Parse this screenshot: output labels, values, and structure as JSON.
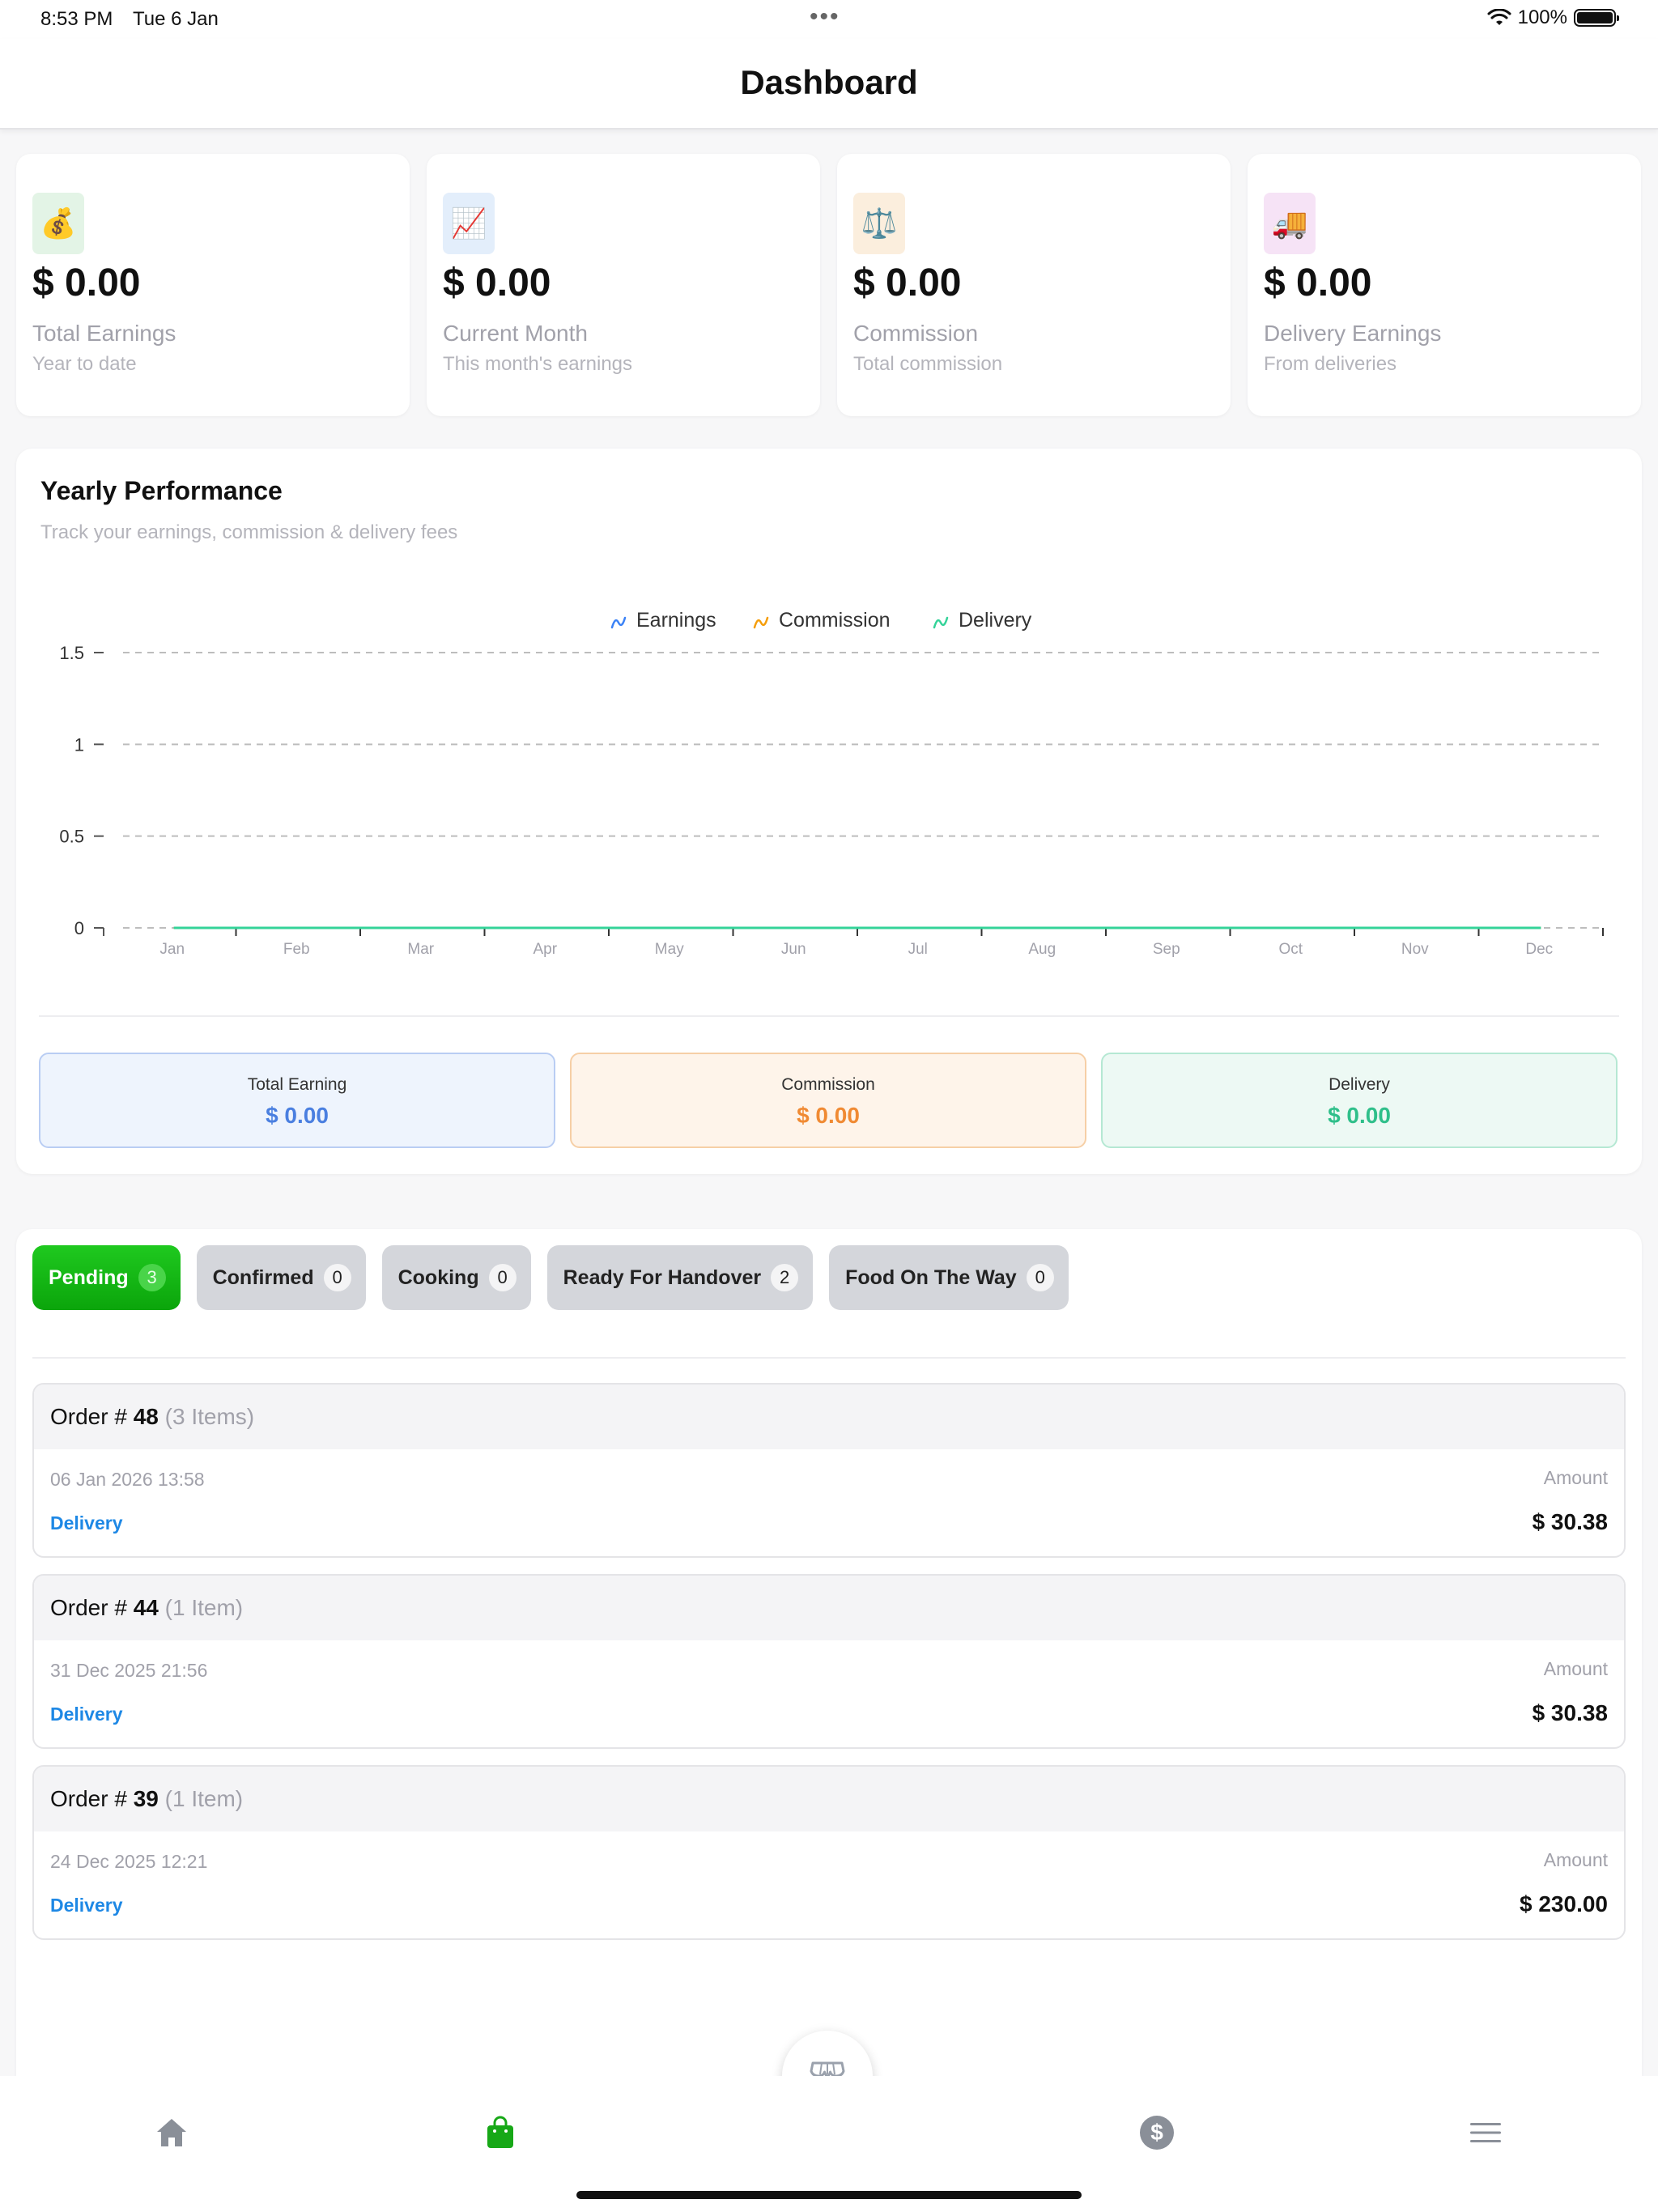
{
  "status_bar": {
    "time": "8:53 PM",
    "date": "Tue 6 Jan",
    "battery": "100%"
  },
  "header": {
    "title": "Dashboard"
  },
  "stats": [
    {
      "icon": "money-bag-icon",
      "glyph": "💰",
      "bg": "#e3f4e6",
      "value": "$ 0.00",
      "title": "Total Earnings",
      "subtitle": "Year to date"
    },
    {
      "icon": "chart-increasing-icon",
      "glyph": "📈",
      "bg": "#e3eefb",
      "value": "$ 0.00",
      "title": "Current Month",
      "subtitle": "This month's earnings"
    },
    {
      "icon": "balance-scale-icon",
      "glyph": "⚖️",
      "bg": "#fbeedd",
      "value": "$ 0.00",
      "title": "Commission",
      "subtitle": "Total commission"
    },
    {
      "icon": "delivery-truck-icon",
      "glyph": "🚚",
      "bg": "#f6e3f6",
      "value": "$ 0.00",
      "title": "Delivery Earnings",
      "subtitle": "From deliveries"
    }
  ],
  "performance": {
    "title": "Yearly Performance",
    "subtitle": "Track your earnings, commission & delivery fees",
    "summary": [
      {
        "label": "Total Earning",
        "value": "$ 0.00",
        "color": "#4a7fe0",
        "bg": "#eef4fd",
        "border": "#b9cdf3"
      },
      {
        "label": "Commission",
        "value": "$ 0.00",
        "color": "#f08a33",
        "bg": "#fef4ea",
        "border": "#f6cfa6"
      },
      {
        "label": "Delivery",
        "value": "$ 0.00",
        "color": "#2fbf8a",
        "bg": "#edf9f4",
        "border": "#b5e8d3"
      }
    ]
  },
  "chart_data": {
    "type": "line",
    "title": "",
    "x": [
      "Jan",
      "Feb",
      "Mar",
      "Apr",
      "May",
      "Jun",
      "Jul",
      "Aug",
      "Sep",
      "Oct",
      "Nov",
      "Dec"
    ],
    "series": [
      {
        "name": "Earnings",
        "color": "#3b82f6",
        "values": [
          0,
          0,
          0,
          0,
          0,
          0,
          0,
          0,
          0,
          0,
          0,
          0
        ]
      },
      {
        "name": "Commission",
        "color": "#f59e0b",
        "values": [
          0,
          0,
          0,
          0,
          0,
          0,
          0,
          0,
          0,
          0,
          0,
          0
        ]
      },
      {
        "name": "Delivery",
        "color": "#34d399",
        "values": [
          0,
          0,
          0,
          0,
          0,
          0,
          0,
          0,
          0,
          0,
          0,
          0
        ]
      }
    ],
    "y_ticks": [
      "0",
      "0.5",
      "1",
      "1.5"
    ],
    "ylim": [
      0,
      1.5
    ],
    "grid": true,
    "legend": "top-center"
  },
  "orders": {
    "tabs": [
      {
        "label": "Pending",
        "count": "3",
        "active": true
      },
      {
        "label": "Confirmed",
        "count": "0"
      },
      {
        "label": "Cooking",
        "count": "0"
      },
      {
        "label": "Ready For Handover",
        "count": "2"
      },
      {
        "label": "Food On The Way",
        "count": "0"
      }
    ],
    "list": [
      {
        "prefix": "Order # ",
        "number": "48",
        "items": "(3 Items)",
        "date": "06 Jan 2026  13:58",
        "type": "Delivery",
        "amount_label": "Amount",
        "amount": "$ 30.38"
      },
      {
        "prefix": "Order # ",
        "number": "44",
        "items": "(1 Item)",
        "date": "31 Dec 2025  21:56",
        "type": "Delivery",
        "amount_label": "Amount",
        "amount": "$ 30.38"
      },
      {
        "prefix": "Order # ",
        "number": "39",
        "items": "(1 Item)",
        "date": "24 Dec 2025  12:21",
        "type": "Delivery",
        "amount_label": "Amount",
        "amount": "$ 230.00"
      }
    ]
  },
  "bottom_nav": [
    {
      "name": "home-icon",
      "active": false
    },
    {
      "name": "shopping-bag-icon",
      "active": true,
      "color": "#17a817"
    },
    {
      "name": "dollar-circle-icon",
      "active": false
    },
    {
      "name": "menu-icon",
      "active": false
    }
  ],
  "fab": {
    "icon": "store-icon"
  }
}
